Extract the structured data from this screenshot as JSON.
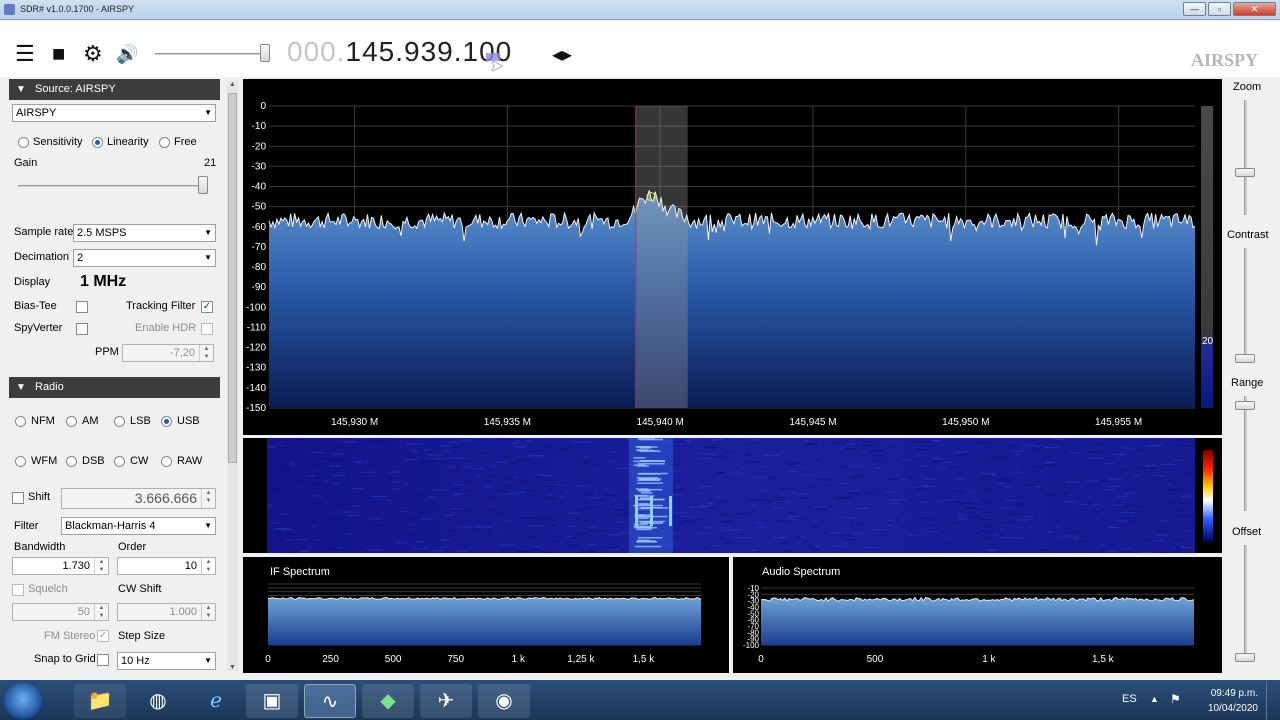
{
  "window": {
    "title": "SDR# v1.0.0.1700 - AIRSPY",
    "min": "—",
    "max": "▫",
    "close": "✕"
  },
  "toolbar": {
    "menu_icon": "☰",
    "stop_icon": "■",
    "settings_icon": "⚙",
    "volume_icon": "🔊",
    "freq_dim": "000.",
    "freq_main": "145.939.",
    "freq_tail": "100",
    "tune_arrows": "◂▸",
    "brand": "AIRSPY"
  },
  "source": {
    "header": "Source: AIRSPY",
    "device": "AIRSPY",
    "modes": [
      "Sensitivity",
      "Linearity",
      "Free"
    ],
    "selected_mode": "Linearity",
    "gain_label": "Gain",
    "gain_value": "21",
    "gain_level": 1.0,
    "sample_rate_label": "Sample rate",
    "sample_rate": "2.5 MSPS",
    "decimation_label": "Decimation",
    "decimation": "2",
    "display_label": "Display",
    "display_value": "1 MHz",
    "bias_tee_label": "Bias-Tee",
    "bias_tee": false,
    "tracking_filter_label": "Tracking Filter",
    "tracking_filter": true,
    "spyverter_label": "SpyVerter",
    "spyverter": false,
    "enable_hdr_label": "Enable HDR",
    "enable_hdr": false,
    "ppm_label": "PPM",
    "ppm": "-7,20"
  },
  "radio": {
    "header": "Radio",
    "modes_row1": [
      "NFM",
      "AM",
      "LSB",
      "USB"
    ],
    "modes_row2": [
      "WFM",
      "DSB",
      "CW",
      "RAW"
    ],
    "selected_mode": "USB",
    "shift_label": "Shift",
    "shift": "3.666.666",
    "filter_label": "Filter",
    "filter": "Blackman-Harris 4",
    "bandwidth_label": "Bandwidth",
    "bandwidth": "1.730",
    "order_label": "Order",
    "order": "10",
    "squelch_label": "Squelch",
    "squelch": "50",
    "cw_shift_label": "CW Shift",
    "cw_shift": "1.000",
    "fm_stereo_label": "FM Stereo",
    "step_size_label": "Step Size",
    "snap_label": "Snap to Grid",
    "step_size": "10 Hz"
  },
  "right": {
    "zoom": "Zoom",
    "contrast": "Contrast",
    "range": "Range",
    "offset": "Offset",
    "scale_value": "20"
  },
  "if_title": "IF Spectrum",
  "audio_title": "Audio Spectrum",
  "taskbar": {
    "lang": "ES",
    "time": "09:49 p.m.",
    "date": "10/04/2020"
  },
  "chart_data": [
    {
      "type": "area",
      "title": "",
      "y_ticks": [
        0,
        -10,
        -20,
        -30,
        -40,
        -50,
        -60,
        -70,
        -80,
        -90,
        -100,
        -110,
        -120,
        -130,
        -140,
        -150
      ],
      "ylim": [
        -150,
        0
      ],
      "x_ticks": [
        "145,930 M",
        "145,935 M",
        "145,940 M",
        "145,945 M",
        "145,950 M",
        "145,955 M"
      ],
      "xlim_mhz": [
        145.9272,
        145.9575
      ],
      "tick_mhz": [
        145.93,
        145.935,
        145.94,
        145.945,
        145.95,
        145.955
      ],
      "noise_floor_db": -57,
      "signal_peak_mhz": 145.9397,
      "signal_peak_db": -45,
      "filter_band_mhz": [
        145.9392,
        145.9409
      ],
      "tuned_mhz": 145.9392,
      "grid": true
    },
    {
      "type": "area",
      "title": "IF Spectrum",
      "x_ticks": [
        "0",
        "250",
        "500",
        "750",
        "1 k",
        "1,25 k",
        "1,5 k"
      ],
      "x_values": [
        0,
        250,
        500,
        750,
        1000,
        1250,
        1500
      ],
      "xlim": [
        0,
        1730
      ],
      "ylim": [
        -170,
        -10
      ],
      "noise_floor_db": -48
    },
    {
      "type": "area",
      "title": "Audio Spectrum",
      "y_ticks": [
        -10,
        -20,
        -30,
        -40,
        -50,
        -60,
        -70,
        -80,
        -90,
        -100
      ],
      "x_ticks": [
        "0",
        "500",
        "1 k",
        "1,5 k"
      ],
      "x_values": [
        0,
        500,
        1000,
        1500
      ],
      "xlim": [
        0,
        1900
      ],
      "ylim": [
        -100,
        -10
      ],
      "noise_floor_db": -28
    }
  ]
}
